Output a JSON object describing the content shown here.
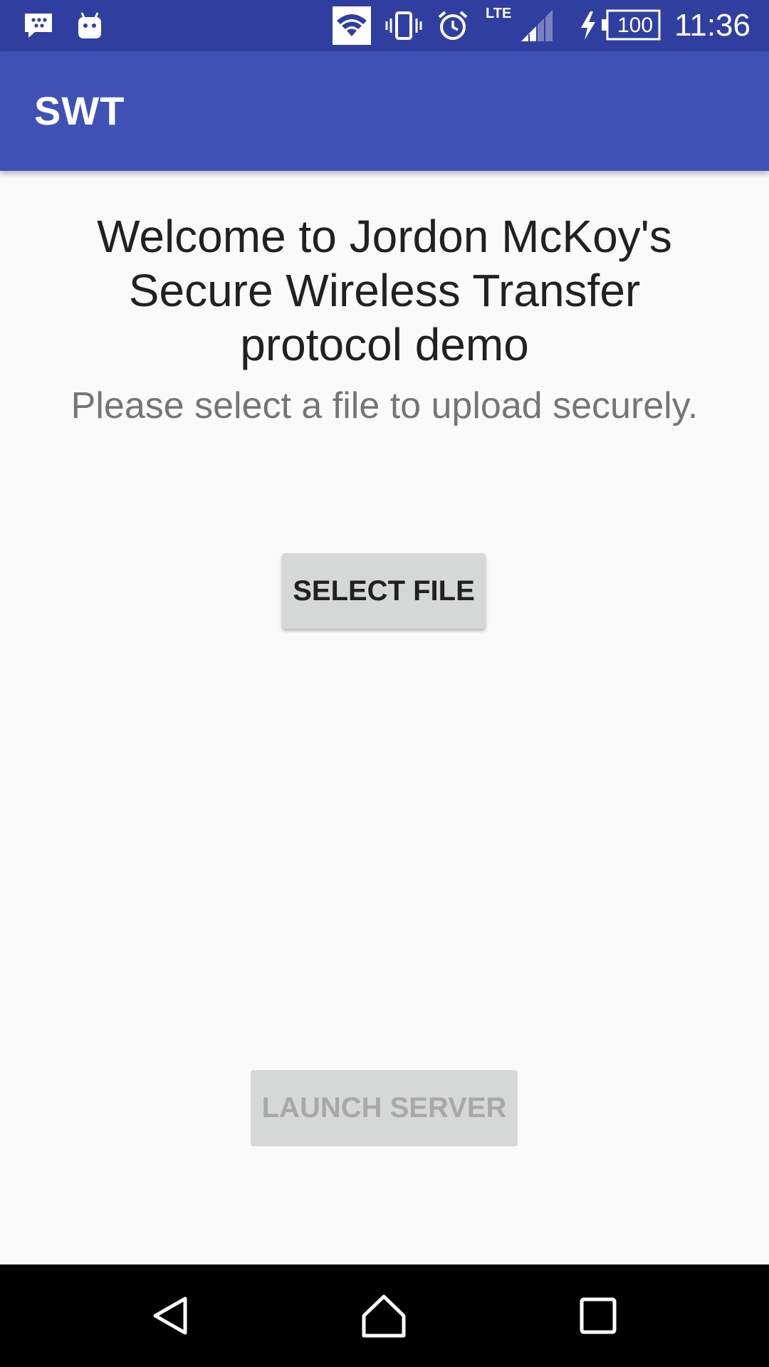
{
  "status_bar": {
    "icons": [
      "bbm-icon",
      "android-notification-icon",
      "wifi-icon",
      "vibrate-icon",
      "alarm-icon",
      "lte-icon",
      "signal-icon",
      "charging-icon",
      "battery-icon"
    ],
    "network_type": "LTE",
    "battery_level": "100",
    "time": "11:36"
  },
  "app_bar": {
    "title": "SWT"
  },
  "main": {
    "welcome_text": "Welcome to Jordon McKoy's Secure Wireless Transfer protocol demo",
    "subtitle": "Please select a file to upload securely.",
    "select_file_label": "SELECT FILE",
    "launch_server_label": "LAUNCH SERVER"
  },
  "nav_bar": {
    "icons": [
      "back-icon",
      "home-icon",
      "recents-icon"
    ]
  },
  "colors": {
    "status_bar": "#303f9f",
    "app_bar": "#3f51b5",
    "background": "#fafafa",
    "button": "#d6d7d7",
    "button_text": "#212121",
    "button_disabled_text": "#a8a8a8"
  }
}
